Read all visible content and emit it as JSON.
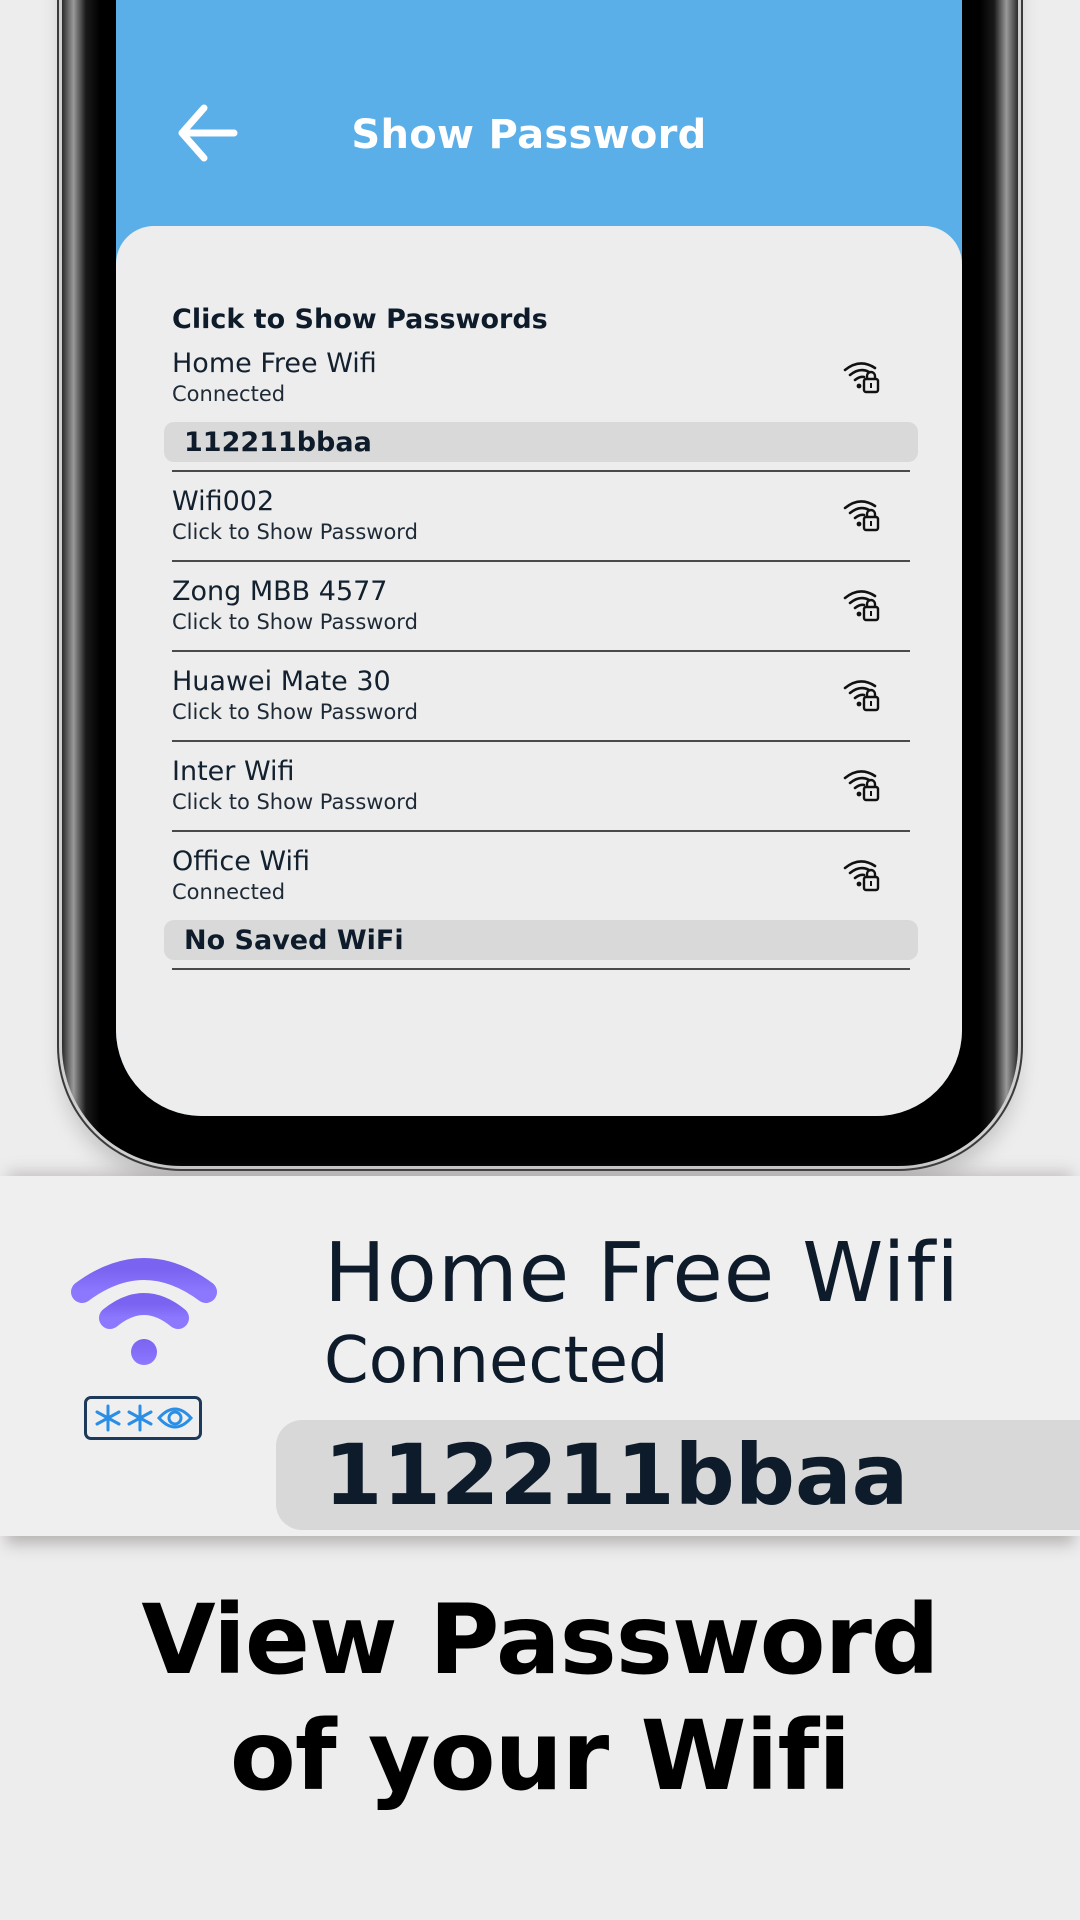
{
  "app": {
    "header": {
      "title": "Show Password",
      "back_icon": "arrow-left-icon",
      "color": "#5aafe8"
    },
    "section_title": "Click to Show Passwords",
    "networks": [
      {
        "name": "Home Free Wifi",
        "status": "Connected",
        "password": "112211bbaa",
        "icon": "wifi-lock-icon"
      },
      {
        "name": "Wifi002",
        "status": "Click to Show Password",
        "password": null,
        "icon": "wifi-lock-icon"
      },
      {
        "name": "Zong MBB 4577",
        "status": "Click to Show Password",
        "password": null,
        "icon": "wifi-lock-icon"
      },
      {
        "name": "Huawei Mate 30",
        "status": "Click to Show Password",
        "password": null,
        "icon": "wifi-lock-icon"
      },
      {
        "name": "Inter Wifi",
        "status": "Click to Show Password",
        "password": null,
        "icon": "wifi-lock-icon"
      },
      {
        "name": "Office Wifi",
        "status": "Connected",
        "password": "No Saved WiFi",
        "icon": "wifi-lock-icon"
      }
    ]
  },
  "zoom_card": {
    "name": "Home Free Wifi",
    "status": "Connected",
    "password": "112211bbaa",
    "wifi_icon": "wifi-icon",
    "wifi_color": "#7b6cf6",
    "badge_icon": "password-reveal-icon",
    "badge_color": "#2a8ee6"
  },
  "caption": {
    "line1": "View Password",
    "line2": "of your Wifi"
  }
}
